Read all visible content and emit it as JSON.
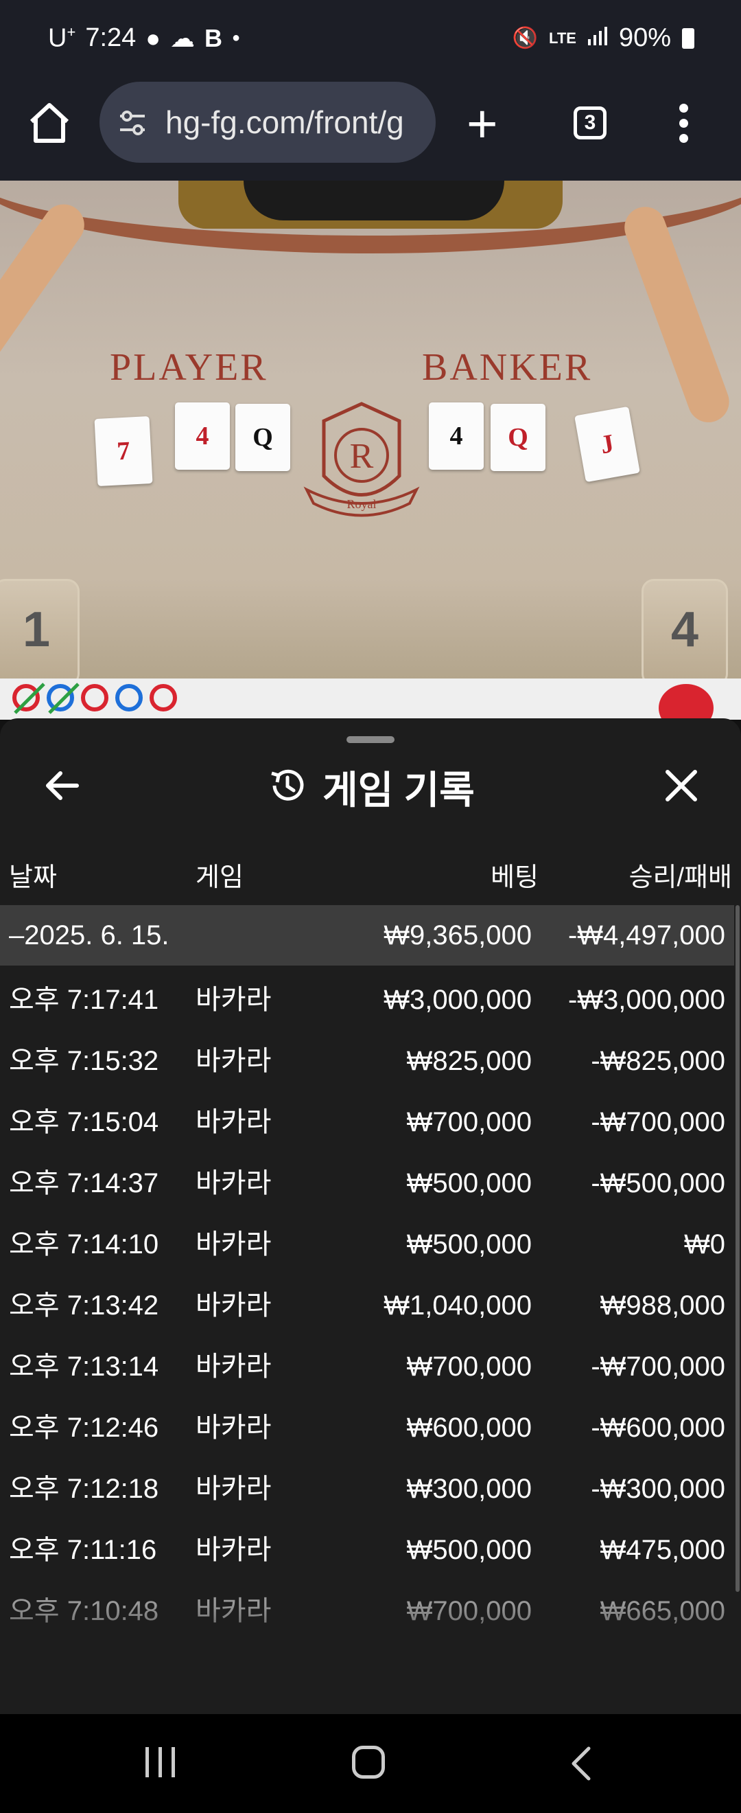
{
  "status_bar": {
    "carrier": "U",
    "carrier_sup": "+",
    "time": "7:24",
    "network": "LTE",
    "battery": "90%"
  },
  "browser": {
    "url": "hg-fg.com/front/g",
    "tab_count": "3"
  },
  "video": {
    "player_label": "PLAYER",
    "banker_label": "BANKER",
    "crest_letter": "R",
    "crest_text": "Royal",
    "seat_left": "1",
    "seat_right": "4",
    "player_cards": [
      {
        "rank": "7",
        "suit": "♥",
        "color": "red"
      },
      {
        "rank": "4",
        "suit": "♦",
        "color": "red"
      },
      {
        "rank": "Q",
        "suit": "♠",
        "color": "blk"
      }
    ],
    "banker_cards": [
      {
        "rank": "4",
        "suit": "♠",
        "color": "blk"
      },
      {
        "rank": "Q",
        "suit": "♥",
        "color": "red"
      },
      {
        "rank": "J",
        "suit": "♦",
        "color": "red"
      }
    ]
  },
  "panel": {
    "title": "게임 기록",
    "columns": {
      "date": "날짜",
      "game": "게임",
      "bet": "베팅",
      "result": "승리/패배"
    },
    "summary": {
      "date": "–2025. 6. 15.",
      "bet": "₩9,365,000",
      "result": "-₩4,497,000"
    },
    "rows": [
      {
        "time": "오후 7:17:41",
        "game": "바카라",
        "bet": "₩3,000,000",
        "result": "-₩3,000,000"
      },
      {
        "time": "오후 7:15:32",
        "game": "바카라",
        "bet": "₩825,000",
        "result": "-₩825,000"
      },
      {
        "time": "오후 7:15:04",
        "game": "바카라",
        "bet": "₩700,000",
        "result": "-₩700,000"
      },
      {
        "time": "오후 7:14:37",
        "game": "바카라",
        "bet": "₩500,000",
        "result": "-₩500,000"
      },
      {
        "time": "오후 7:14:10",
        "game": "바카라",
        "bet": "₩500,000",
        "result": "₩0"
      },
      {
        "time": "오후 7:13:42",
        "game": "바카라",
        "bet": "₩1,040,000",
        "result": "₩988,000"
      },
      {
        "time": "오후 7:13:14",
        "game": "바카라",
        "bet": "₩700,000",
        "result": "-₩700,000"
      },
      {
        "time": "오후 7:12:46",
        "game": "바카라",
        "bet": "₩600,000",
        "result": "-₩600,000"
      },
      {
        "time": "오후 7:12:18",
        "game": "바카라",
        "bet": "₩300,000",
        "result": "-₩300,000"
      },
      {
        "time": "오후 7:11:16",
        "game": "바카라",
        "bet": "₩500,000",
        "result": "₩475,000"
      },
      {
        "time": "오후 7:10:48",
        "game": "바카라",
        "bet": "₩700,000",
        "result": "₩665,000"
      }
    ]
  },
  "icons": {
    "home": "home-icon",
    "tune": "tune-icon",
    "add_tab": "plus-icon",
    "menu": "more-vert-icon",
    "back": "arrow-left-icon",
    "history": "history-icon",
    "close": "close-icon",
    "nav_recent": "recent-apps-icon",
    "nav_home": "nav-home-icon",
    "nav_back": "nav-back-icon"
  },
  "colors": {
    "panel_bg": "#1d1d1d",
    "summary_bg": "#3d3d3d",
    "browser_bg": "#1c1e26",
    "road_player": "#1e6fd9",
    "road_banker": "#d9242f",
    "road_tie": "#2ea043"
  }
}
